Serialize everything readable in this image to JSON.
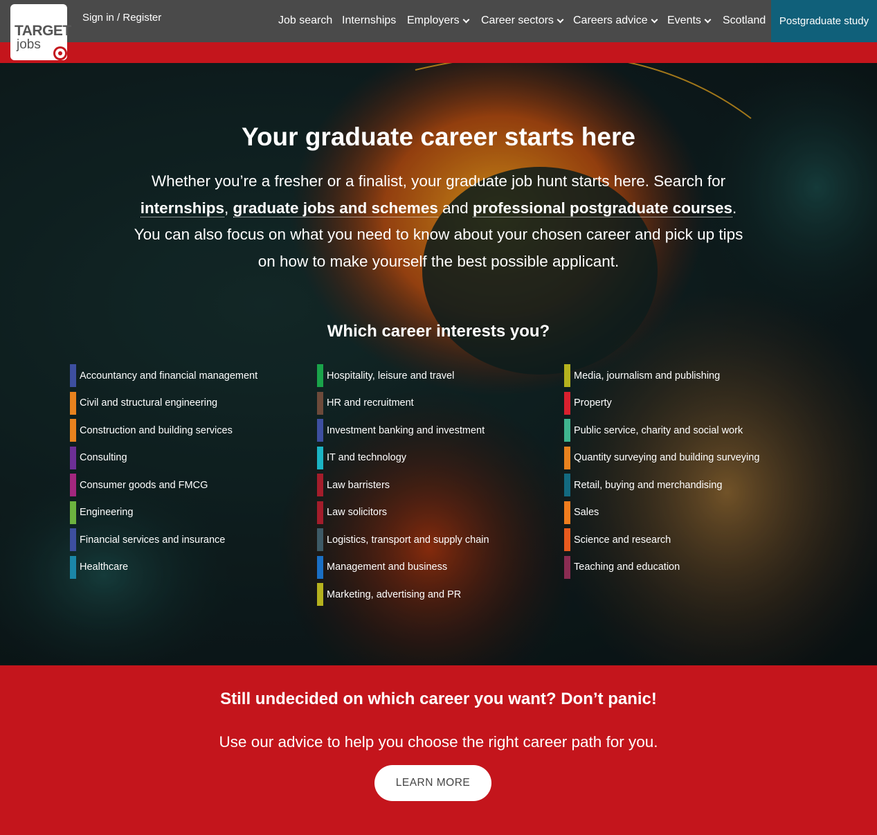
{
  "header": {
    "logo_line1": "TARGET",
    "logo_line2": "jobs",
    "signin": "Sign in / Register",
    "nav": [
      {
        "label": "Job search",
        "dropdown": false
      },
      {
        "label": "Internships",
        "dropdown": false
      },
      {
        "label": "Employers",
        "dropdown": true
      },
      {
        "label": "Career sectors",
        "dropdown": true
      },
      {
        "label": "Careers advice",
        "dropdown": true
      },
      {
        "label": "Events",
        "dropdown": true
      },
      {
        "label": "Scotland",
        "dropdown": false
      }
    ],
    "highlight_nav": "Postgraduate study"
  },
  "hero": {
    "title": "Your graduate career starts here",
    "intro_1": "Whether you’re a fresher or a finalist, your graduate job hunt starts here. Search for",
    "link_internships": "internships",
    "sep_comma": ",",
    "link_jobs": "graduate jobs and schemes",
    "and_word": "and",
    "link_courses": "professional postgraduate courses",
    "intro_2": ". You can also focus on what you need to know about your chosen career and pick up tips on how to make yourself the best possible applicant.",
    "careers_heading": "Which career interests you?"
  },
  "careers": {
    "col1": [
      {
        "label": "Accountancy and financial management",
        "color": "#3d4fa0"
      },
      {
        "label": "Civil and structural engineering",
        "color": "#e8821e"
      },
      {
        "label": "Construction and building services",
        "color": "#e8821e"
      },
      {
        "label": "Consulting",
        "color": "#6d2f96"
      },
      {
        "label": "Consumer goods and FMCG",
        "color": "#a3277e"
      },
      {
        "label": "Engineering",
        "color": "#6db33f"
      },
      {
        "label": "Financial services and insurance",
        "color": "#3d4fa0"
      },
      {
        "label": "Healthcare",
        "color": "#1b87a8"
      }
    ],
    "col2": [
      {
        "label": "Hospitality, leisure and travel",
        "color": "#1aa34a"
      },
      {
        "label": "HR and recruitment",
        "color": "#6d4a3a"
      },
      {
        "label": "Investment banking and investment",
        "color": "#3d4fa0"
      },
      {
        "label": "IT and technology",
        "color": "#1bb4c4"
      },
      {
        "label": "Law barristers",
        "color": "#a31d2b"
      },
      {
        "label": "Law solicitors",
        "color": "#a31d2b"
      },
      {
        "label": "Logistics, transport and supply chain",
        "color": "#3d5a66"
      },
      {
        "label": "Management and business",
        "color": "#1a6fc4"
      },
      {
        "label": "Marketing, advertising and PR",
        "color": "#b5b21e"
      }
    ],
    "col3": [
      {
        "label": "Media, journalism and publishing",
        "color": "#b5b21e"
      },
      {
        "label": "Property",
        "color": "#d9202e"
      },
      {
        "label": "Public service, charity and social work",
        "color": "#3fb58f"
      },
      {
        "label": "Quantity surveying and building surveying",
        "color": "#e8821e"
      },
      {
        "label": "Retail, buying and merchandising",
        "color": "#136a80"
      },
      {
        "label": "Sales",
        "color": "#f07d1e"
      },
      {
        "label": "Science and research",
        "color": "#e85a1e"
      },
      {
        "label": "Teaching and education",
        "color": "#8a2c52"
      }
    ]
  },
  "cta": {
    "heading": "Still undecided on which career you want? Don’t panic!",
    "text": "Use our advice to help you choose the right career path for you.",
    "button": "LEARN MORE"
  },
  "colors": {
    "brand_red": "#c4151c",
    "header_grey": "#4a4a4a",
    "postgrad_teal": "#10607a"
  }
}
